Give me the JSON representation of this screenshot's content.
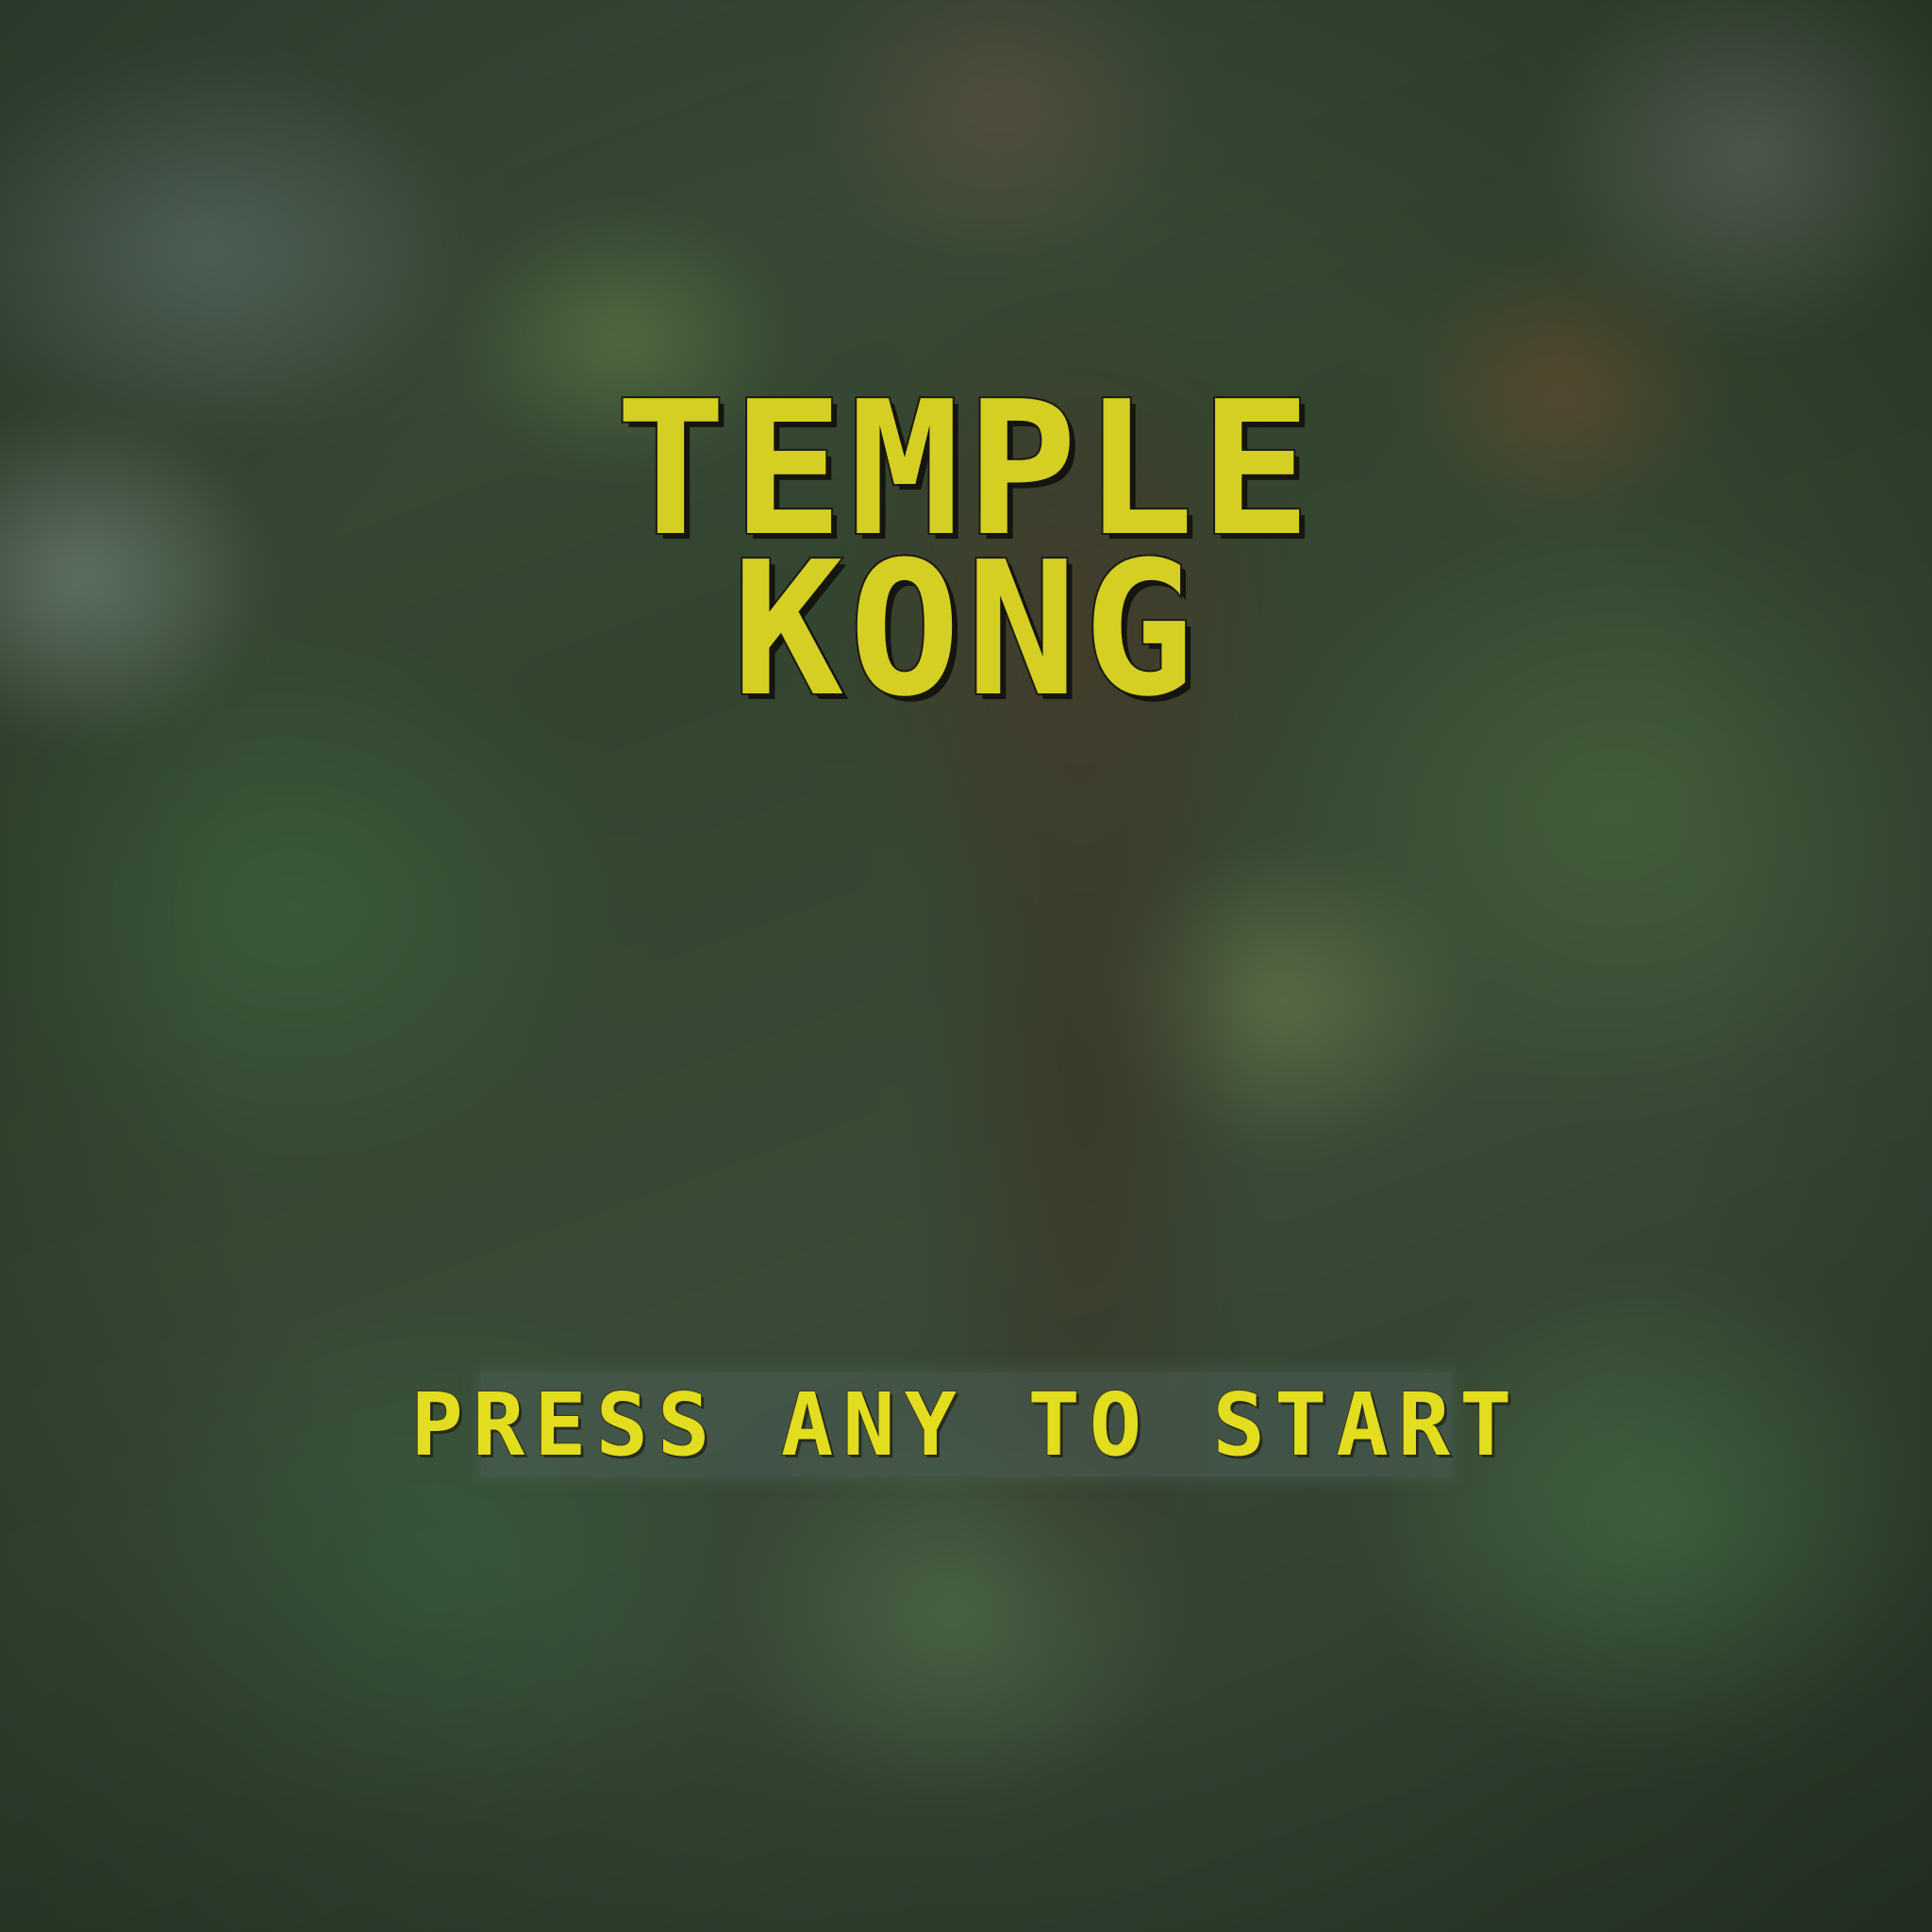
{
  "screen": {
    "name": "title-screen",
    "background": "blurred jungle foliage"
  },
  "title": {
    "line1": "TEMPLE",
    "line2": "KONG",
    "color": "#d4cf22"
  },
  "prompt": {
    "label": "PRESS ANY TO START",
    "color": "#e2dd1e"
  }
}
